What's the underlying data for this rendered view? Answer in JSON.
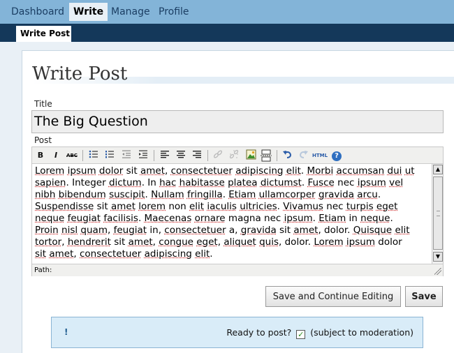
{
  "nav": {
    "items": [
      {
        "label": "Dashboard",
        "active": false
      },
      {
        "label": "Write",
        "active": true
      },
      {
        "label": "Manage",
        "active": false
      },
      {
        "label": "Profile",
        "active": false
      }
    ]
  },
  "subnav": {
    "tab": "Write Post"
  },
  "page": {
    "title": "Write Post"
  },
  "form": {
    "title_label": "Title",
    "title_value": "The Big Question",
    "post_label": "Post",
    "path_label": "Path:"
  },
  "toolbar": {
    "icons": [
      "bold-icon",
      "italic-icon",
      "strikethrough-icon",
      "bullet-list-icon",
      "numbered-list-icon",
      "outdent-icon",
      "indent-icon",
      "align-left-icon",
      "align-center-icon",
      "align-right-icon",
      "link-icon",
      "unlink-icon",
      "image-icon",
      "page-break-icon",
      "undo-icon",
      "redo-icon",
      "html-icon",
      "help-icon"
    ],
    "bold": "B",
    "italic": "I",
    "strike": "ABC",
    "html": "HTML",
    "help": "?"
  },
  "editor": {
    "lines": [
      [
        "Lorem",
        " ",
        "ipsum",
        " ",
        "dolor",
        " sit ",
        "amet",
        ", ",
        "consectetuer",
        " ",
        "adipiscing",
        " ",
        "elit",
        ". ",
        "Morbi",
        " ",
        "accumsan",
        " ",
        "dui",
        " ",
        "ut"
      ],
      [
        "sapien",
        ". Integer ",
        "dictum",
        ". In ",
        "hac",
        " ",
        "habitasse",
        " ",
        "platea",
        " ",
        "dictumst",
        ". ",
        "Fusce",
        " nec ",
        "ipsum",
        " ",
        "vel"
      ],
      [
        "nibh",
        " ",
        "bibendum",
        " ",
        "suscipit",
        ". ",
        "Nullam",
        " ",
        "fringilla",
        ". ",
        "Etiam",
        " ",
        "ullamcorper",
        " ",
        "gravida",
        " ",
        "arcu",
        "."
      ],
      [
        "Suspendisse",
        " sit ",
        "amet",
        " ",
        "lorem",
        " non ",
        "elit",
        " ",
        "iaculis",
        " ",
        "ultricies",
        ". ",
        "Vivamus",
        " nec ",
        "turpis",
        " ",
        "eget"
      ],
      [
        "neque",
        " ",
        "feugiat",
        " ",
        "facilisis",
        ". ",
        "Maecenas",
        " ",
        "ornare",
        " magna nec ",
        "ipsum",
        ". ",
        "Etiam",
        " in ",
        "neque",
        "."
      ],
      [
        "Proin",
        " ",
        "nisl",
        " ",
        "quam",
        ", ",
        "feugiat",
        " in, ",
        "consectetuer",
        " a, ",
        "gravida",
        " sit ",
        "amet",
        ", dolor. ",
        "Quisque",
        " ",
        "elit"
      ],
      [
        "tortor",
        ", ",
        "hendrerit",
        " sit ",
        "amet",
        ", ",
        "congue",
        " ",
        "eget",
        ", ",
        "aliquet",
        " ",
        "quis",
        ", dolor. ",
        "Lorem",
        " ",
        "ipsum",
        " dolor"
      ],
      [
        "sit",
        " ",
        "amet",
        ", ",
        "consectetuer",
        " ",
        "adipiscing",
        " ",
        "elit",
        "."
      ]
    ]
  },
  "actions": {
    "save_continue": "Save and Continue Editing",
    "save": "Save"
  },
  "notice": {
    "icon": "!",
    "ready": "Ready to post?",
    "moderation": "(subject to moderation)",
    "checked": true
  }
}
